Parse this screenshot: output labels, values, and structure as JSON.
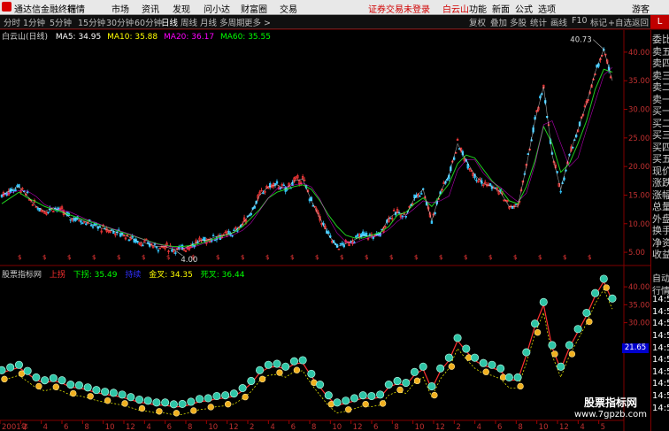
{
  "menubar": {
    "app_title": "通达信金融终端",
    "items": [
      "行情",
      "市场",
      "资讯",
      "发现",
      "问小达",
      "财富圈",
      "交易"
    ],
    "notice": "证券交易未登录",
    "stock_name": "白云山",
    "right_items": [
      "功能",
      "新面",
      "公式",
      "选项"
    ],
    "user": "游客"
  },
  "toolbar": {
    "periods": [
      "分时",
      "1分钟",
      "5分钟",
      "15分钟",
      "30分钟",
      "60分钟",
      "日线",
      "周线",
      "月线",
      "多周期",
      "更多 >"
    ],
    "active_period": "日线",
    "tools": [
      "复权",
      "叠加",
      "多股",
      "统计",
      "画线",
      "F10",
      "标记",
      "+自选",
      "返回"
    ],
    "right_mark": "L"
  },
  "main_indicator": {
    "title": "白云山(日线)",
    "ma": [
      {
        "label": "MA5: 34.95",
        "color": "#ffffff"
      },
      {
        "label": "MA10: 35.88",
        "color": "#ffff00"
      },
      {
        "label": "MA20: 36.17",
        "color": "#ff00ff"
      },
      {
        "label": "MA60: 35.55",
        "color": "#00ff00"
      }
    ]
  },
  "sub_indicator": {
    "title": "股票指标网",
    "items": [
      {
        "label": "上拐",
        "color": "#ff3030"
      },
      {
        "label": "下拐: 35.49",
        "color": "#00ff00"
      },
      {
        "label": "持续",
        "color": "#3030ff"
      },
      {
        "label": "金叉: 34.35",
        "color": "#ffff00"
      },
      {
        "label": "死叉: 36.44",
        "color": "#00ff00"
      }
    ],
    "price_tag": "21.65"
  },
  "price_axis": {
    "ticks": [
      "40.00",
      "35.00",
      "30.00",
      "25.00",
      "20.00",
      "15.00",
      "10.00",
      "5.00"
    ],
    "sub_ticks": [
      "40.00",
      "35.00",
      "30.00"
    ],
    "high_label": "40.73",
    "low_label": "4.00"
  },
  "side_list": [
    "委比",
    "卖五",
    "卖四",
    "卖三",
    "卖二",
    "卖一",
    "买一",
    "买二",
    "买三",
    "买四",
    "买五",
    "现价",
    "涨跌",
    "涨幅",
    "总量",
    "外盘",
    "换手",
    "净资",
    "收益"
  ],
  "side_sub": [
    "自动",
    "行情",
    "14:50",
    "14:50",
    "14:50",
    "14:50",
    "14:50",
    "14:50",
    "14:50",
    "14:50",
    "14:50",
    "14:50"
  ],
  "time_axis": [
    "2001年",
    "2",
    "4",
    "6",
    "8",
    "10",
    "12",
    "4",
    "6",
    "8",
    "10",
    "12",
    "2",
    "4",
    "6",
    "8",
    "10",
    "12",
    "6",
    "8",
    "10",
    "12",
    "2",
    "4",
    "6",
    "8",
    "10",
    "12",
    "4",
    "5"
  ],
  "watermark": {
    "line1": "股票指标网",
    "line2": "www.7gpzb.com"
  },
  "chart_data": {
    "type": "line",
    "title": "白云山(日线)",
    "ylim": [
      3,
      42
    ],
    "series": [
      {
        "name": "MA60",
        "values": [
          13.5,
          14.5,
          15.5,
          14.5,
          13.8,
          13.0,
          12.5,
          12.0,
          11.5,
          11.0,
          10.5,
          10.0,
          9.5,
          9.0,
          8.5,
          8.0,
          7.5,
          7.0,
          6.5,
          6.2,
          6.0,
          6.0,
          6.2,
          6.5,
          7.0,
          7.5,
          8.0,
          8.5,
          9.5,
          11.0,
          12.5,
          14.5,
          15.5,
          16.0,
          16.5,
          16.8,
          16.0,
          14.0,
          11.5,
          9.5,
          8.0,
          7.5,
          7.5,
          8.0,
          8.5,
          9.5,
          11.5,
          12.0,
          13.5,
          14.5,
          13.0,
          15.0,
          17.0,
          20.5,
          22.0,
          21.5,
          19.5,
          17.5,
          16.0,
          14.0,
          13.5,
          16.5,
          21.0,
          27.0,
          24.0,
          19.0,
          20.5,
          24.0,
          28.0,
          33.5,
          37.0,
          36.5
        ]
      },
      {
        "name": "Close",
        "values": [
          15.0,
          15.8,
          16.5,
          14.8,
          13.0,
          12.2,
          12.8,
          12.2,
          11.0,
          10.8,
          10.2,
          9.5,
          9.0,
          8.7,
          8.2,
          7.5,
          6.8,
          6.5,
          6.0,
          6.0,
          5.5,
          5.6,
          6.2,
          7.0,
          7.2,
          7.8,
          8.0,
          8.5,
          10.0,
          12.0,
          15.0,
          16.5,
          16.8,
          16.0,
          17.5,
          17.8,
          14.0,
          11.0,
          8.0,
          6.0,
          6.5,
          7.2,
          8.0,
          7.8,
          8.2,
          11.0,
          12.0,
          11.5,
          14.5,
          16.0,
          10.5,
          15.5,
          18.5,
          24.0,
          21.0,
          18.5,
          17.0,
          16.5,
          15.5,
          13.0,
          13.0,
          20.0,
          28.0,
          34.0,
          22.0,
          16.0,
          22.0,
          26.5,
          31.0,
          36.5,
          40.5,
          35.0
        ]
      }
    ]
  }
}
